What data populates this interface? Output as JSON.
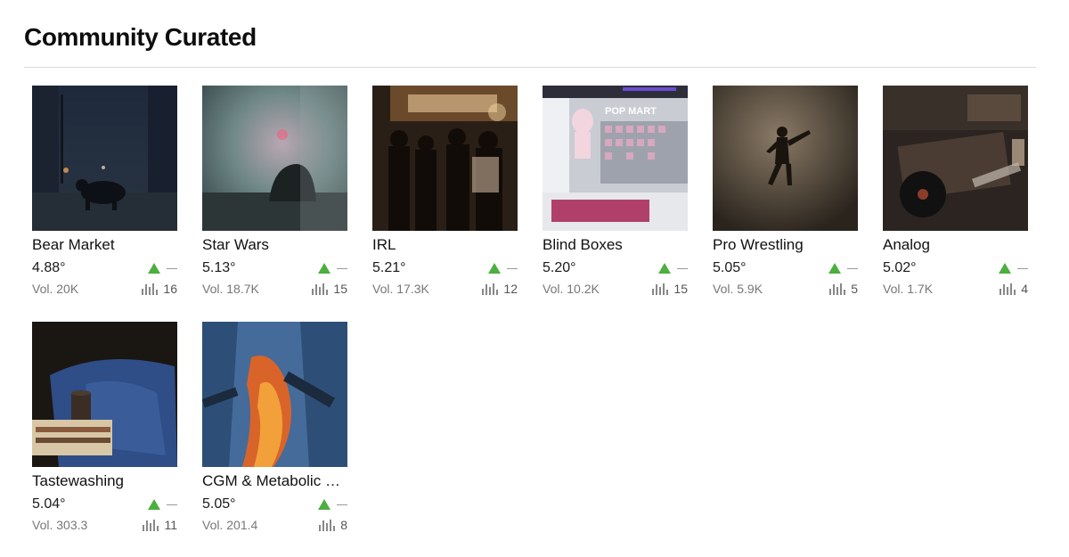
{
  "page": {
    "title": "Community Curated"
  },
  "cards": [
    {
      "name": "Bear Market",
      "temperature": "4.88°",
      "volume": "Vol. 20K",
      "count": "16",
      "trend_color": "#4caf3f",
      "image": "bear-city-night"
    },
    {
      "name": "Star Wars",
      "temperature": "5.13°",
      "volume": "Vol. 18.7K",
      "count": "15",
      "trend_color": "#4caf3f",
      "image": "foggy-creature"
    },
    {
      "name": "IRL",
      "temperature": "5.21°",
      "volume": "Vol. 17.3K",
      "count": "12",
      "trend_color": "#4caf3f",
      "image": "night-crowd"
    },
    {
      "name": "Blind Boxes",
      "temperature": "5.20°",
      "volume": "Vol. 10.2K",
      "count": "15",
      "trend_color": "#4caf3f",
      "image": "pop-mart-store",
      "image_text": "POP MART"
    },
    {
      "name": "Pro Wrestling",
      "temperature": "5.05°",
      "volume": "Vol. 5.9K",
      "count": "5",
      "trend_color": "#4caf3f",
      "image": "wrestler-leap"
    },
    {
      "name": "Analog",
      "temperature": "5.02°",
      "volume": "Vol. 1.7K",
      "count": "4",
      "trend_color": "#4caf3f",
      "image": "vinyl-desk"
    },
    {
      "name": "Tastewashing",
      "temperature": "5.04°",
      "volume": "Vol. 303.3",
      "count": "11",
      "trend_color": "#4caf3f",
      "image": "denim-books-mug"
    },
    {
      "name": "CGM & Metabolic Health",
      "temperature": "5.05°",
      "volume": "Vol. 201.4",
      "count": "8",
      "trend_color": "#4caf3f",
      "image": "xray-thermal"
    }
  ]
}
